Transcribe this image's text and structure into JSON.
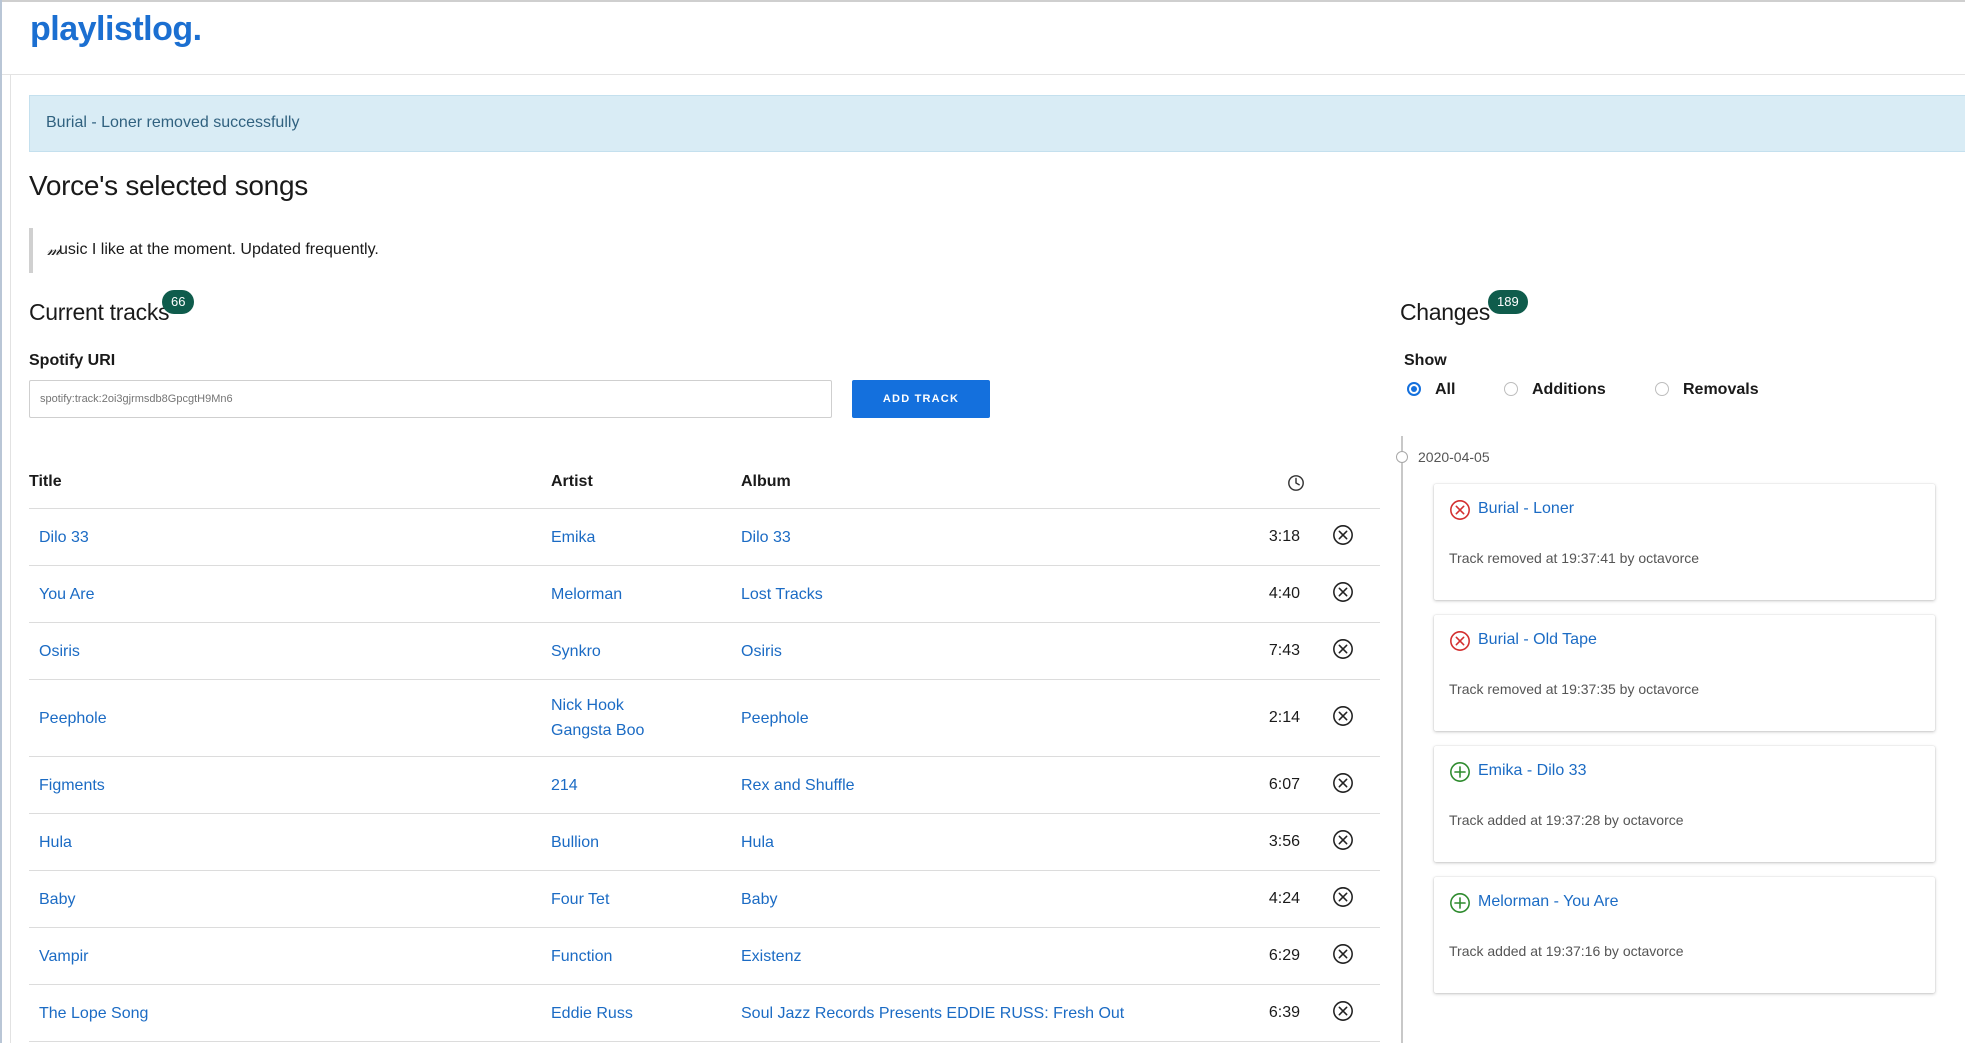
{
  "app": {
    "logo": "playlistlog."
  },
  "alert": {
    "message": "Burial - Loner removed successfully"
  },
  "playlist": {
    "title": "Vorce's selected songs",
    "description": "usic I like at the moment. Updated frequently."
  },
  "tracks_section": {
    "title": "Current tracks",
    "count": "66",
    "field_label": "Spotify URI",
    "input_placeholder": "spotify:track:2oi3gjrmsdb8GpcgtH9Mn6",
    "add_button": "ADD TRACK",
    "columns": {
      "title": "Title",
      "artist": "Artist",
      "album": "Album",
      "duration_icon": "clock-icon"
    },
    "rows": [
      {
        "title": "Dilo 33",
        "artists": [
          "Emika"
        ],
        "album": "Dilo 33",
        "duration": "3:18"
      },
      {
        "title": "You Are",
        "artists": [
          "Melorman"
        ],
        "album": "Lost Tracks",
        "duration": "4:40"
      },
      {
        "title": "Osiris",
        "artists": [
          "Synkro"
        ],
        "album": "Osiris",
        "duration": "7:43"
      },
      {
        "title": "Peephole",
        "artists": [
          "Nick Hook",
          "Gangsta Boo"
        ],
        "album": "Peephole",
        "duration": "2:14"
      },
      {
        "title": "Figments",
        "artists": [
          "214"
        ],
        "album": "Rex and Shuffle",
        "duration": "6:07"
      },
      {
        "title": "Hula",
        "artists": [
          "Bullion"
        ],
        "album": "Hula",
        "duration": "3:56"
      },
      {
        "title": "Baby",
        "artists": [
          "Four Tet"
        ],
        "album": "Baby",
        "duration": "4:24"
      },
      {
        "title": "Vampir",
        "artists": [
          "Function"
        ],
        "album": "Existenz",
        "duration": "6:29"
      },
      {
        "title": "The Lope Song",
        "artists": [
          "Eddie Russ"
        ],
        "album": "Soul Jazz Records Presents EDDIE RUSS: Fresh Out",
        "duration": "6:39"
      }
    ]
  },
  "changes_section": {
    "title": "Changes",
    "count": "189",
    "filter_label": "Show",
    "filters": [
      {
        "label": "All",
        "checked": true
      },
      {
        "label": "Additions",
        "checked": false
      },
      {
        "label": "Removals",
        "checked": false
      }
    ],
    "date": "2020-04-05",
    "items": [
      {
        "type": "removed",
        "icon": "remove-circle-icon",
        "title": "Burial - Loner",
        "detail": "Track removed at 19:37:41 by octavorce"
      },
      {
        "type": "removed",
        "icon": "remove-circle-icon",
        "title": "Burial - Old Tape",
        "detail": "Track removed at 19:37:35 by octavorce"
      },
      {
        "type": "added",
        "icon": "add-circle-icon",
        "title": "Emika - Dilo 33",
        "detail": "Track added at 19:37:28 by octavorce"
      },
      {
        "type": "added",
        "icon": "add-circle-icon",
        "title": "Melorman - You Are",
        "detail": "Track added at 19:37:16 by octavorce"
      }
    ]
  },
  "colors": {
    "brand": "#1b6fd1",
    "link": "#1b6bc4",
    "badge": "#0f5c4c",
    "button": "#1470dd",
    "alert_bg": "#d9ecf5",
    "removed": "#d32f2f",
    "added": "#2e8b2e"
  }
}
